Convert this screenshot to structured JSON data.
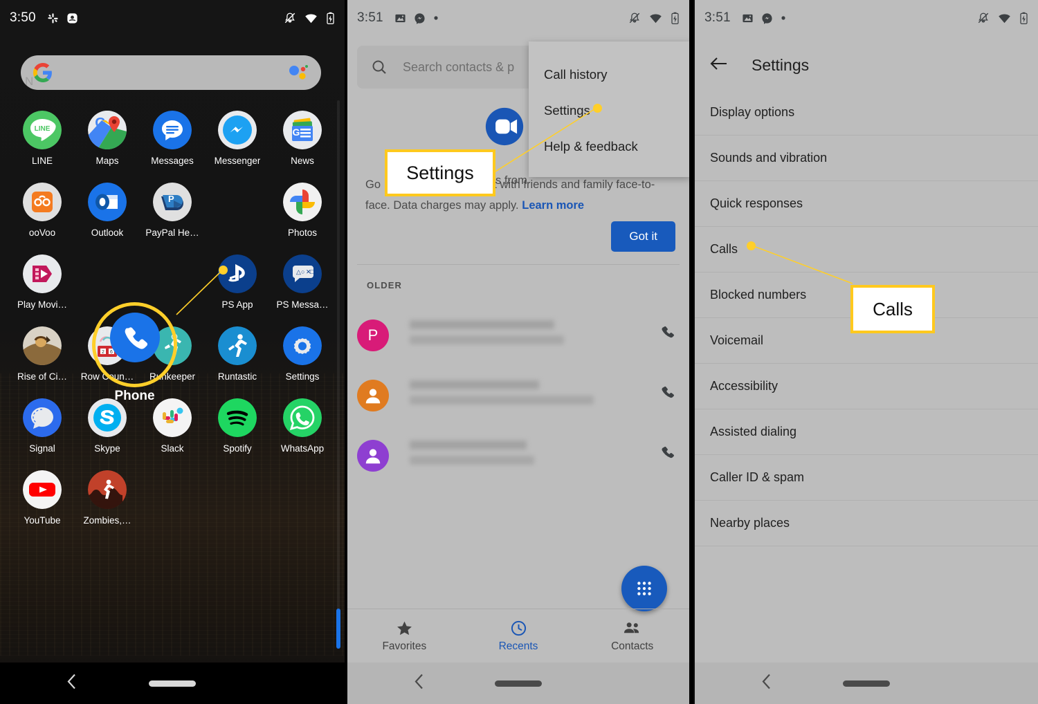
{
  "panels": {
    "home": {
      "status": {
        "time": "3:50",
        "left_icons": [
          "slack-icon",
          "smiley-app-icon"
        ],
        "right_icons": [
          "notifications-silenced-icon",
          "wifi-icon",
          "battery-charging-icon"
        ]
      },
      "search": {
        "placeholder": "",
        "logo": "google-g-logo",
        "assistant": "google-assistant-icon",
        "ghost_text": "N"
      },
      "apps": [
        {
          "label": "LINE",
          "icon": "line-icon"
        },
        {
          "label": "Maps",
          "icon": "google-maps-icon"
        },
        {
          "label": "Messages",
          "icon": "google-messages-icon"
        },
        {
          "label": "Messenger",
          "icon": "facebook-messenger-icon"
        },
        {
          "label": "News",
          "icon": "google-news-icon"
        },
        {
          "label": "ooVoo",
          "icon": "oovoo-icon"
        },
        {
          "label": "Outlook",
          "icon": "outlook-icon"
        },
        {
          "label": "PayPal He…",
          "icon": "paypal-here-icon"
        },
        {
          "label": "Phone",
          "icon": "phone-icon"
        },
        {
          "label": "Photos",
          "icon": "google-photos-icon"
        },
        {
          "label": "Play Movi…",
          "icon": "play-movies-icon"
        },
        {
          "label": "",
          "icon": ""
        },
        {
          "label": "",
          "icon": ""
        },
        {
          "label": "PS App",
          "icon": "playstation-app-icon"
        },
        {
          "label": "PS Messa…",
          "icon": "playstation-messages-icon"
        },
        {
          "label": "Rise of Ci…",
          "icon": "rise-of-civilizations-icon"
        },
        {
          "label": "Row Coun…",
          "icon": "row-counter-icon"
        },
        {
          "label": "Runkeeper",
          "icon": "runkeeper-icon"
        },
        {
          "label": "Runtastic",
          "icon": "runtastic-icon"
        },
        {
          "label": "Settings",
          "icon": "settings-gear-icon"
        },
        {
          "label": "Signal",
          "icon": "signal-icon"
        },
        {
          "label": "Skype",
          "icon": "skype-icon"
        },
        {
          "label": "Slack",
          "icon": "slack-icon"
        },
        {
          "label": "Spotify",
          "icon": "spotify-icon"
        },
        {
          "label": "WhatsApp",
          "icon": "whatsapp-icon"
        },
        {
          "label": "YouTube",
          "icon": "youtube-icon"
        },
        {
          "label": "Zombies,…",
          "icon": "zombies-run-icon"
        }
      ],
      "highlighted_app_label": "Phone"
    },
    "dialer": {
      "status": {
        "time": "3:51",
        "left_icons": [
          "photo-icon",
          "facebook-messenger-icon",
          "dot-icon"
        ],
        "right_icons": [
          "notifications-silenced-icon",
          "wifi-icon",
          "battery-charging-icon"
        ]
      },
      "search_placeholder": "Search contacts & p",
      "overflow_menu": [
        "Call history",
        "Settings",
        "Help & feedback"
      ],
      "promo": {
        "logo": "google-duo-logo",
        "headline_fragment": "s from",
        "body_start": "Go",
        "body": "lets you chat with friends and family face-to-face. Data charges may apply.",
        "link": "Learn more",
        "button": "Got it"
      },
      "section_header": "OLDER",
      "call_rows": [
        {
          "avatar_letter": "P",
          "avatar_color": "#d81b78",
          "action": "call-icon"
        },
        {
          "avatar_letter": "",
          "avatar_color": "#e07b20",
          "action": "call-icon"
        },
        {
          "avatar_letter": "",
          "avatar_color": "#8e3fd1",
          "action": "call-icon"
        }
      ],
      "fab": "dialpad-icon",
      "tabs": [
        {
          "label": "Favorites",
          "icon": "star-icon",
          "active": false
        },
        {
          "label": "Recents",
          "icon": "clock-icon",
          "active": true
        },
        {
          "label": "Contacts",
          "icon": "people-icon",
          "active": false
        }
      ]
    },
    "settings": {
      "status": {
        "time": "3:51",
        "left_icons": [
          "photo-icon",
          "facebook-messenger-icon",
          "dot-icon"
        ],
        "right_icons": [
          "notifications-silenced-icon",
          "wifi-icon",
          "battery-charging-icon"
        ]
      },
      "back_icon": "back-arrow-icon",
      "title": "Settings",
      "items": [
        "Display options",
        "Sounds and vibration",
        "Quick responses",
        "Calls",
        "Blocked numbers",
        "Voicemail",
        "Accessibility",
        "Assisted dialing",
        "Caller ID & spam",
        "Nearby places"
      ]
    }
  },
  "annotations": {
    "callouts": [
      {
        "text": "Phone"
      },
      {
        "text": "Settings"
      },
      {
        "text": "Calls"
      }
    ],
    "accent_color": "#ffcf2a",
    "callout_bg": "#ffffff"
  },
  "colors": {
    "home_bg": "#121212",
    "light_panel_bg": "#bdbdbd",
    "blue_accent": "#185abc",
    "link_blue": "#1a56b5"
  }
}
